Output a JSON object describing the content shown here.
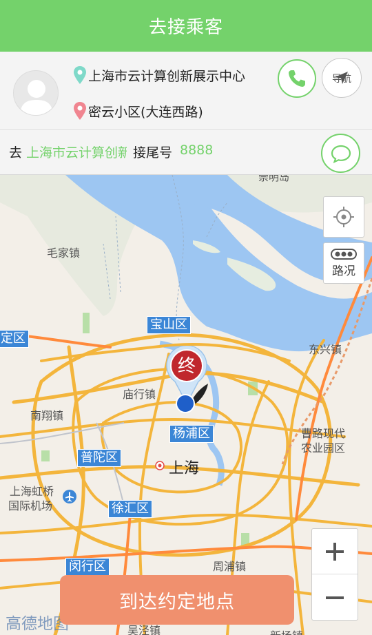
{
  "header": {
    "title": "去接乘客"
  },
  "passenger": {
    "from_address": "上海市云计算创新展示中心",
    "to_address": "密云小区(大连西路)"
  },
  "actions": {
    "call_icon": "phone-icon",
    "nav_label": "导航",
    "nav_icon": "navigation-arrow-icon",
    "message_icon": "chat-bubble-icon"
  },
  "tail": {
    "go_label": "去",
    "destination": "上海市云计算创新展示中心",
    "tail_label": "接尾号",
    "tail_number": "8888"
  },
  "map": {
    "labels": {
      "chongming": "崇明岛",
      "maojia": "毛家镇",
      "baoshan": "宝山区",
      "jiading": "定区",
      "dongxing": "东兴镇",
      "miaohang": "庙行镇",
      "nanxiang": "南翔镇",
      "yangpu": "杨浦区",
      "caolu_1": "曹路现代",
      "caolu_2": "农业园区",
      "putuo": "普陀区",
      "shanghai": "上海",
      "hongqiao_1": "上海虹桥",
      "hongqiao_2": "国际机场",
      "xuhui": "徐汇区",
      "zhoupu": "周浦镇",
      "minhang": "闵行区",
      "wujing": "吴泾镇",
      "xinchang": "新场镇"
    },
    "brand": "高德地图",
    "end_marker": "终",
    "locate_icon": "locate-icon",
    "traffic_label": "路况",
    "traffic_icon": "traffic-icon",
    "zoom_in_icon": "plus-icon",
    "zoom_out_icon": "minus-icon"
  },
  "arrive_button": {
    "label": "到达约定地点"
  },
  "colors": {
    "accent_green": "#74d26b",
    "arrive_orange": "#f0906e",
    "water": "#9dc6f2",
    "district_blue": "#3b86d6"
  }
}
